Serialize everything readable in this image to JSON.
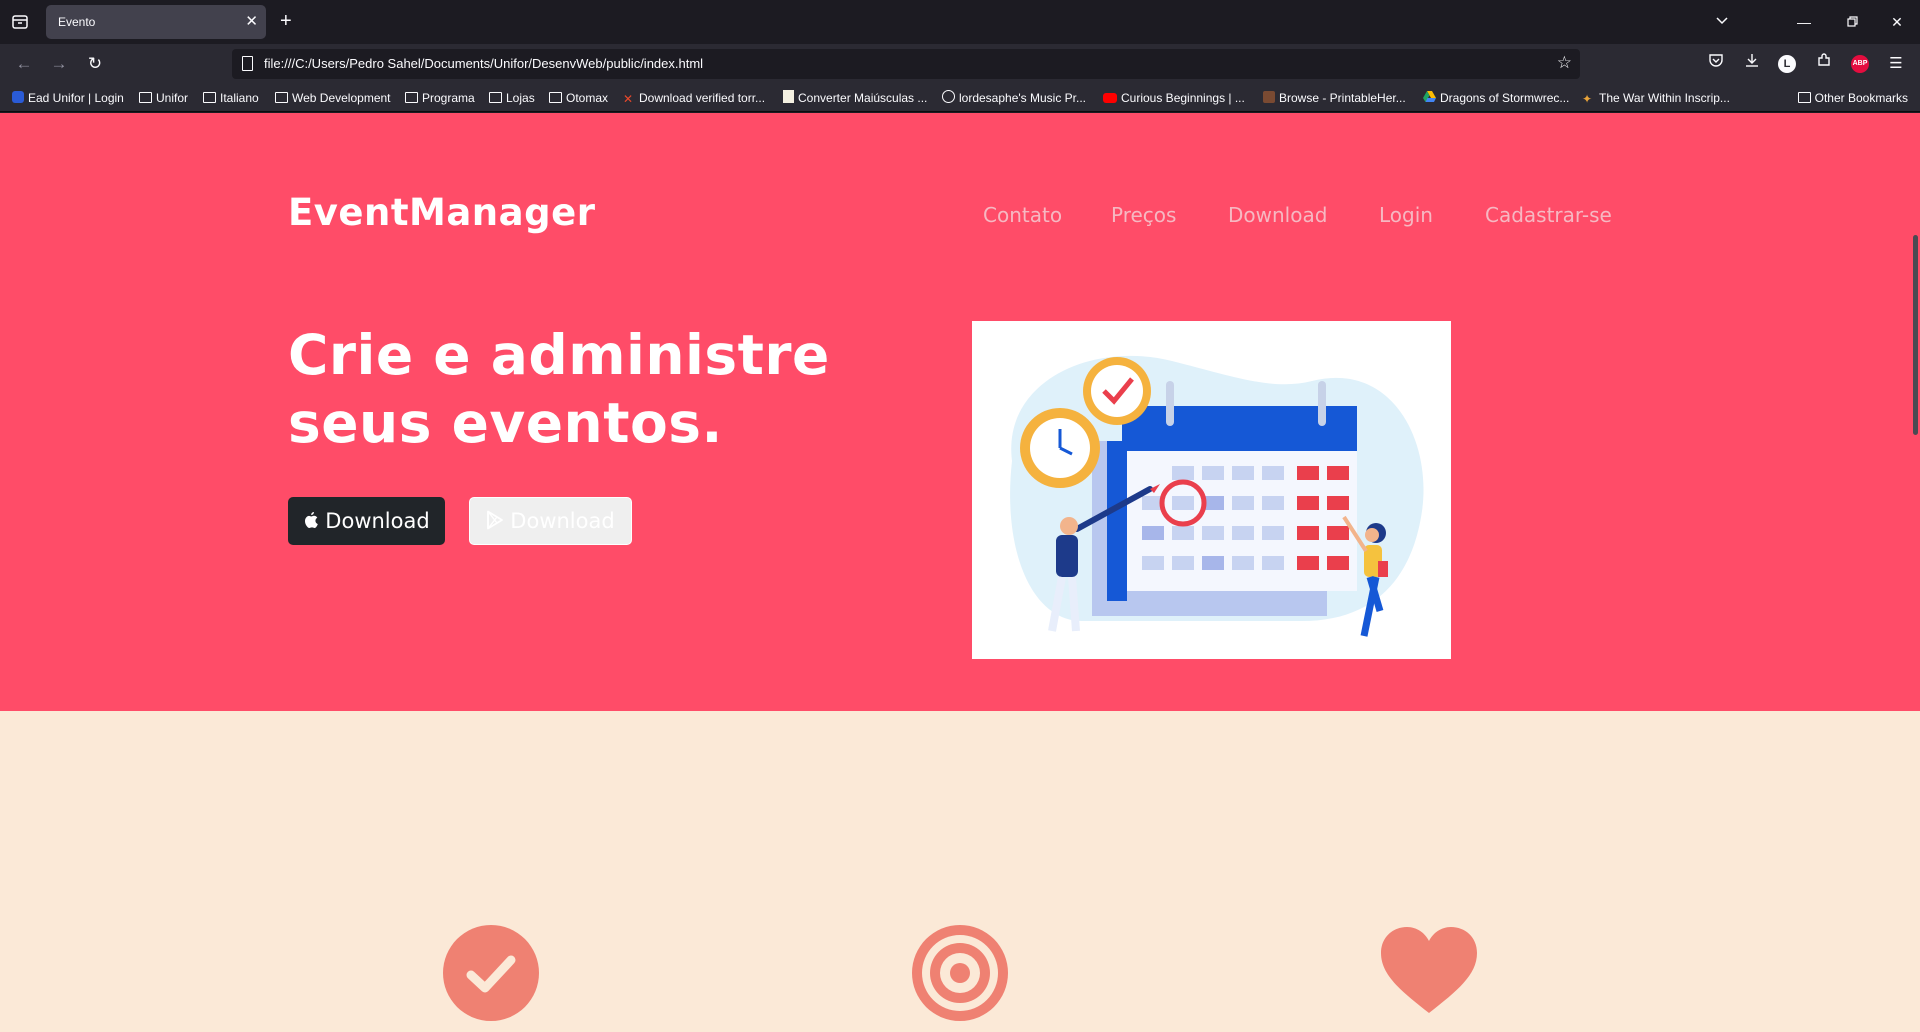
{
  "browser": {
    "tab": {
      "title": "Evento"
    },
    "url": "file:///C:/Users/Pedro Sahel/Documents/Unifor/DesenvWeb/public/index.html",
    "bookmarks": [
      "Ead Unifor | Login",
      "Unifor",
      "Italiano",
      "Web Development",
      "Programa",
      "Lojas",
      "Otomax",
      "Download verified torr...",
      "Converter Maiúsculas ...",
      "lordesaphe's Music Pr...",
      "Curious Beginnings | ...",
      "Browse - PrintableHer...",
      "Dragons of Stormwrec...",
      "The War Within Inscrip..."
    ],
    "other_bookmarks": "Other Bookmarks"
  },
  "site": {
    "brand": "EventManager",
    "nav": [
      "Contato",
      "Preços",
      "Download",
      "Login",
      "Cadastrar-se"
    ],
    "headline_line1": "Crie e administre",
    "headline_line2": "seus eventos.",
    "btn_apple": "Download",
    "btn_play": "Download"
  },
  "features": [
    {
      "icon": "check-circle-icon"
    },
    {
      "icon": "bullseye-icon"
    },
    {
      "icon": "heart-icon"
    }
  ],
  "colors": {
    "hero_bg": "#ff4c68",
    "features_bg": "#fbe9d7",
    "feature_icon": "#ef8172"
  }
}
